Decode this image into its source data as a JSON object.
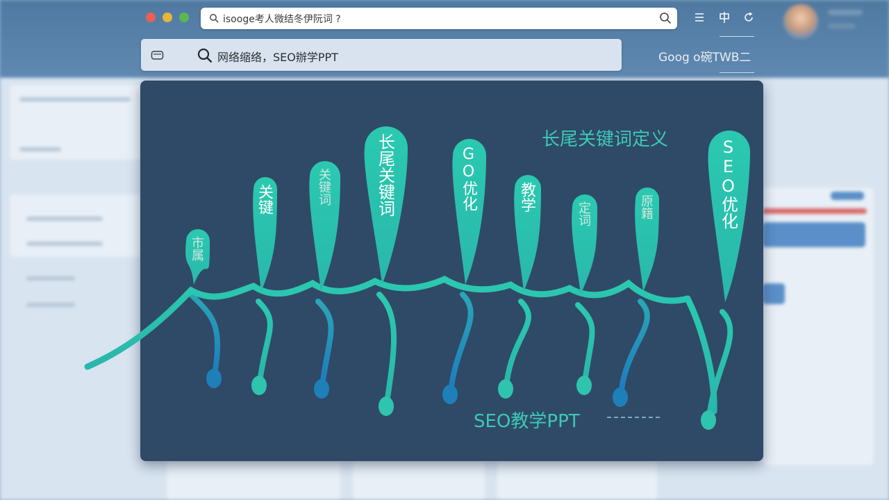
{
  "browser": {
    "address": "isooge考人微结冬伊阮词 ?",
    "search_query": "网络缩络，SEO辦学PPT",
    "brand": "Goog o碗TWB二"
  },
  "slide": {
    "title": "长尾关键词定义",
    "subtitle": "SEO教学PPT",
    "leaves": [
      {
        "label": "市属",
        "style": "faint"
      },
      {
        "label": "关键",
        "style": "normal"
      },
      {
        "label": "关键词",
        "style": "faint"
      },
      {
        "label": "长尾关键词",
        "style": "large"
      },
      {
        "label": "GO优化",
        "style": "normal"
      },
      {
        "label": "教学",
        "style": "normal"
      },
      {
        "label": "定词",
        "style": "faint"
      },
      {
        "label": "原籍",
        "style": "faint"
      },
      {
        "label": "SEO优化",
        "style": "large"
      }
    ]
  },
  "colors": {
    "teal": "#2ec4ad",
    "blue": "#1f7fb8",
    "slide_bg": "#2f4a66"
  },
  "icons": [
    "search-icon",
    "camera-icon",
    "menu-icon",
    "split-view-icon",
    "reload-icon"
  ]
}
